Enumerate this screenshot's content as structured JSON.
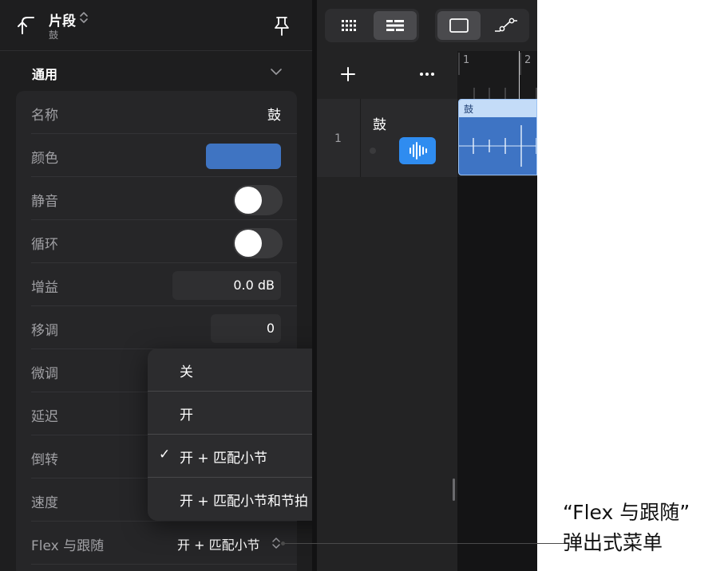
{
  "header": {
    "title": "片段",
    "subtitle": "鼓"
  },
  "section": {
    "title": "通用"
  },
  "rows": {
    "name": {
      "label": "名称",
      "value": "鼓"
    },
    "color": {
      "label": "颜色",
      "color": "#3f74c2"
    },
    "mute": {
      "label": "静音",
      "on": false
    },
    "loop": {
      "label": "循环",
      "on": false
    },
    "gain": {
      "label": "增益",
      "value": "0.0 dB"
    },
    "transpose": {
      "label": "移调",
      "value": "0"
    },
    "finetune": {
      "label": "微调"
    },
    "delay": {
      "label": "延迟"
    },
    "reverse": {
      "label": "倒转"
    },
    "speed": {
      "label": "速度"
    },
    "flex": {
      "label": "Flex 与跟随",
      "value": "开 + 匹配小节"
    }
  },
  "menu": {
    "items": [
      {
        "label": "关",
        "checked": false
      },
      {
        "label": "开",
        "checked": false
      },
      {
        "label": "开 + 匹配小节",
        "checked": true
      },
      {
        "label": "开 + 匹配小节和节拍",
        "checked": false
      }
    ],
    "check_glyph": "✓"
  },
  "tracks": {
    "ruler": [
      "1",
      "2"
    ],
    "list": [
      {
        "number": "1",
        "name": "鼓"
      }
    ],
    "region": {
      "name": "鼓",
      "color": "#3e74c4"
    }
  },
  "callout": {
    "line1": "“Flex 与跟随”",
    "line2": "弹出式菜单"
  }
}
